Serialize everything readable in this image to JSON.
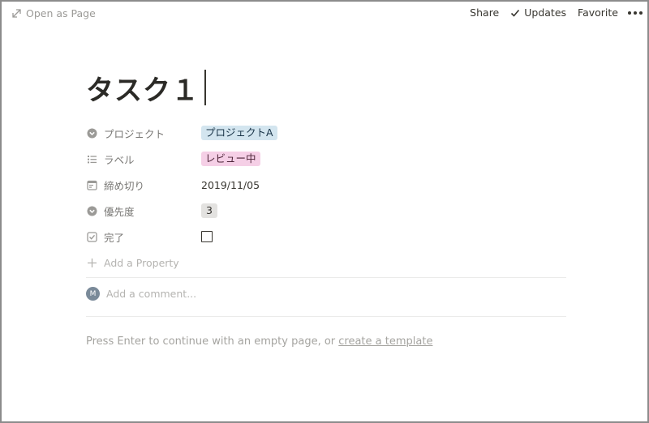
{
  "topbar": {
    "open_as_page": "Open as Page",
    "share": "Share",
    "updates": "Updates",
    "favorite": "Favorite"
  },
  "page": {
    "title": "タスク１"
  },
  "properties": [
    {
      "name": "プロジェクト",
      "icon": "select-icon",
      "value": "プロジェクトA",
      "type": "tag",
      "color": "#d3e5ef"
    },
    {
      "name": "ラベル",
      "icon": "list-icon",
      "value": "レビュー中",
      "type": "tag",
      "color": "#f5cfe6"
    },
    {
      "name": "締め切り",
      "icon": "calendar-icon",
      "value": "2019/11/05",
      "type": "date"
    },
    {
      "name": "優先度",
      "icon": "select-icon",
      "value": "3",
      "type": "tag",
      "color": "#e3e2e0"
    },
    {
      "name": "完了",
      "icon": "checkbox-icon",
      "value": "",
      "type": "checkbox",
      "checked": false
    }
  ],
  "add_property": "Add a Property",
  "comment": {
    "avatar_initial": "M",
    "placeholder": "Add a comment..."
  },
  "hint": {
    "text": "Press Enter to continue with an empty page, or ",
    "link": "create a template"
  }
}
